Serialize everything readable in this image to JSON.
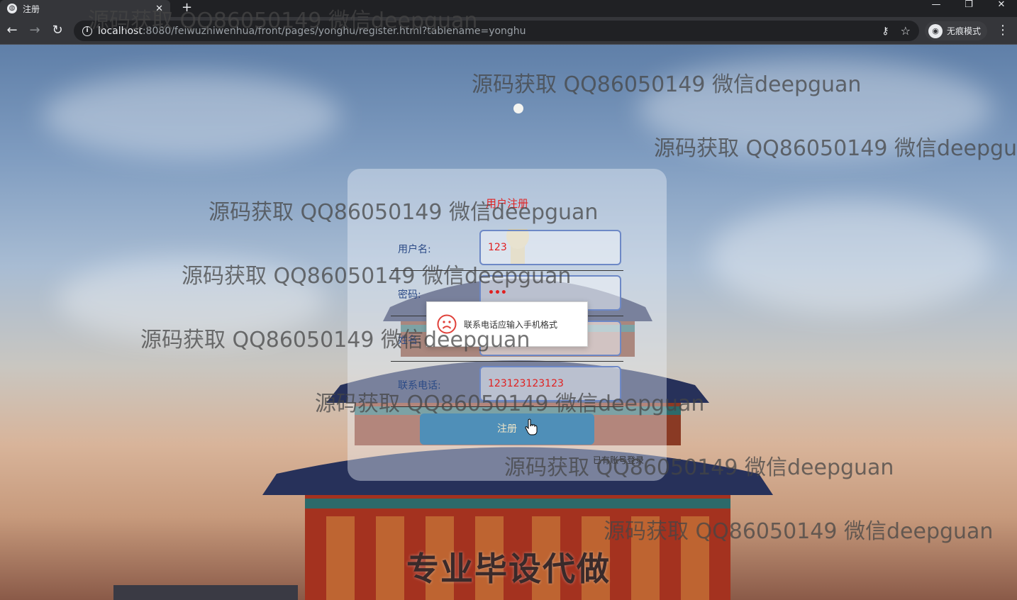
{
  "browser": {
    "tab_title": "注册",
    "tab_close": "✕",
    "new_tab": "+",
    "window_controls": {
      "minimize": "—",
      "restore": "❐",
      "close": "✕"
    },
    "nav": {
      "back": "←",
      "forward": "→",
      "reload": "↻"
    },
    "url_host": "localhost",
    "url_rest": ":8080/feiwuzhiwenhua/front/pages/yonghu/register.html?tablename=yonghu",
    "incognito_label": "无痕模式",
    "menu": "⋮"
  },
  "register": {
    "title": "用户注册",
    "fields": [
      {
        "label": "用户名:",
        "value": "123"
      },
      {
        "label": "密码:",
        "value": "•••"
      },
      {
        "label": "姓名:",
        "value": ""
      },
      {
        "label": "联系电话:",
        "value": "123123123123"
      }
    ],
    "submit_label": "注册",
    "login_link": "已有账号登录"
  },
  "toast": {
    "message": "联系电话应输入手机格式"
  },
  "watermarks": [
    "源码获取 QQ86050149 微信deepguan",
    "源码获取 QQ86050149 微信deepguan",
    "源码获取 QQ86050149 微信deepgua",
    "源码获取 QQ86050149 微信deepguan",
    "源码获取 QQ86050149 微信deepguan",
    "源码获取 QQ86050149 微信deepguan",
    "源码获取 QQ86050149 微信deepguan",
    "源码获取 QQ86050149 微信deepguan",
    "源码获取 QQ86050149 微信deepguan"
  ],
  "promo_text": "专业毕设代做",
  "colors": {
    "accent_red": "#e02020",
    "label_blue": "#2b4a86",
    "button_blue": "#4f8fb8",
    "field_border": "#6d88c6"
  }
}
